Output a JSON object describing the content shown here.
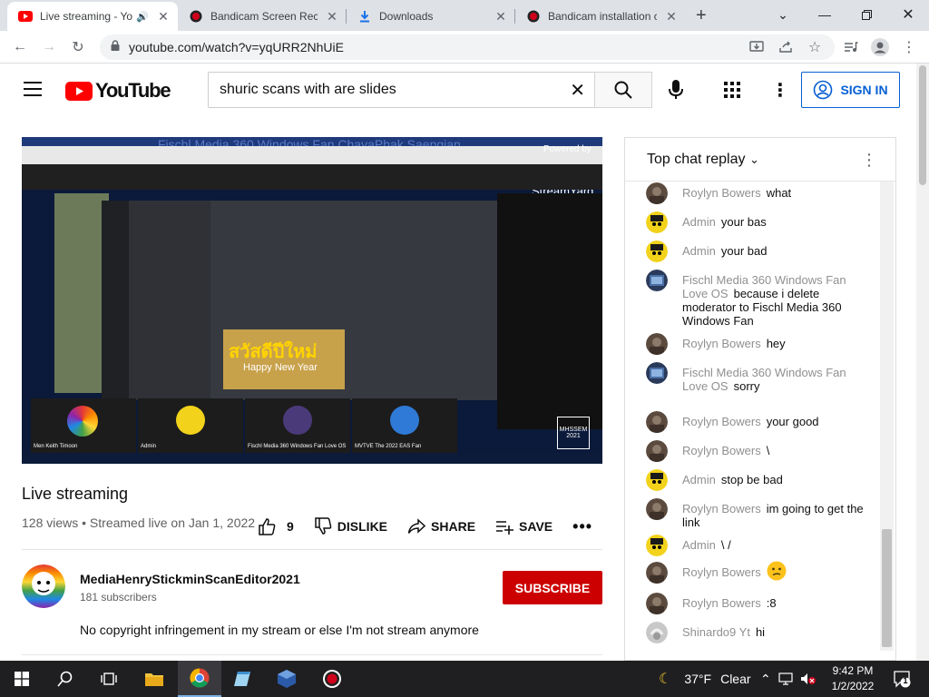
{
  "browser": {
    "tabs": [
      {
        "title": "Live streaming - Yo",
        "icon": "youtube-icon",
        "active": true,
        "audio": true
      },
      {
        "title": "Bandicam Screen Reco",
        "icon": "bandicam-icon",
        "active": false
      },
      {
        "title": "Downloads",
        "icon": "download-icon",
        "active": false
      },
      {
        "title": "Bandicam installation c",
        "icon": "bandicam-icon",
        "active": false
      }
    ],
    "url": "youtube.com/watch?v=yqURR2NhUiE"
  },
  "youtube": {
    "logo_text": "YouTube",
    "search_query": "shuric scans with are slides",
    "signin_label": "SIGN IN"
  },
  "video": {
    "player_overlay_title": "Fischl Media 360 Windows Fan ChayaPhak Saengian",
    "powered_by": "Powered by",
    "streamyard": "StreamYard",
    "title": "Live streaming",
    "meta": "128 views • Streamed live on Jan 1, 2022",
    "likes": "9",
    "dislike_label": "DISLIKE",
    "share_label": "SHARE",
    "save_label": "SAVE",
    "participants": [
      "Men Keith Timoon",
      "Admin",
      "Fischl Media 360 Windows Fan Love OS",
      "MVTVE The 2022 EAS Fan"
    ],
    "thumb_text": "Happy New Year",
    "thumb_title": "สวัสดีปีใหม่",
    "logo_box": "MHSSEM 2021"
  },
  "channel": {
    "name": "MediaHenryStickminScanEditor2021",
    "subscribers": "181 subscribers",
    "subscribe_label": "SUBSCRIBE",
    "description": "No copyright infringement in my stream or else I'm not stream anymore"
  },
  "chat": {
    "header": "Top chat replay",
    "messages": [
      {
        "author": "Roylyn Bowers",
        "text": "what",
        "avatar": "roylyn"
      },
      {
        "author": "Admin",
        "text": "your bas",
        "avatar": "admin"
      },
      {
        "author": "Admin",
        "text": "your bad",
        "avatar": "admin"
      },
      {
        "author": "Fischl Media 360 Windows Fan Love OS",
        "text": "because i delete moderator to Fischl Media 360 Windows Fan",
        "avatar": "fischl"
      },
      {
        "author": "Roylyn Bowers",
        "text": "hey",
        "avatar": "roylyn"
      },
      {
        "author": "Fischl Media 360 Windows Fan Love OS",
        "text": "sorry",
        "avatar": "fischl"
      },
      {
        "author": "Roylyn Bowers",
        "text": "your good",
        "avatar": "roylyn"
      },
      {
        "author": "Roylyn Bowers",
        "text": "\\",
        "avatar": "roylyn"
      },
      {
        "author": "Admin",
        "text": "stop be bad",
        "avatar": "admin"
      },
      {
        "author": "Roylyn Bowers",
        "text": "im going to get the link",
        "avatar": "roylyn"
      },
      {
        "author": "Admin",
        "text": "\\ /",
        "avatar": "admin"
      },
      {
        "author": "Roylyn Bowers",
        "text": "",
        "avatar": "roylyn",
        "emoji": "confused-face"
      },
      {
        "author": "Roylyn Bowers",
        "text": ":8",
        "avatar": "roylyn"
      },
      {
        "author": "Shinardo9 Yt",
        "text": "hi",
        "avatar": "shinardo"
      }
    ]
  },
  "taskbar": {
    "temperature": "37°F",
    "weather": "Clear",
    "time": "9:42 PM",
    "date": "1/2/2022",
    "notifications": "1"
  }
}
